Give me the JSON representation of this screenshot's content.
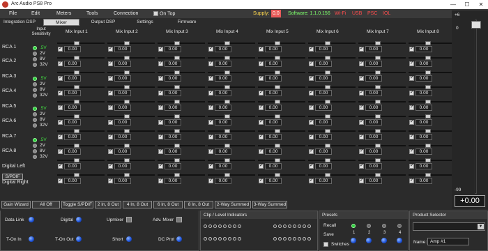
{
  "window": {
    "title": "Arc Audio PS8 Pro",
    "btn_min": "—",
    "btn_max": "☐",
    "btn_close": "✕"
  },
  "menu": {
    "items": [
      "File",
      "Edit",
      "Meters",
      "Tools",
      "Connection"
    ],
    "on_top_label": "On Top",
    "supply_label": "Supply:",
    "supply_value": "0.0",
    "software_label": "Software: 1.1.0.156",
    "wifi_label": "Wi-Fi",
    "usb_label": "USB",
    "psc_label": "PSC",
    "iol_label": "IOL",
    "colors": {
      "status_red": "#ff4d4d",
      "software_green": "#7dff6b",
      "supply_yellow": "#ffd84d"
    }
  },
  "tabs": [
    {
      "label": "Integration DSP",
      "active": false
    },
    {
      "label": "Mixer",
      "active": true
    },
    {
      "label": "Output DSP",
      "active": false
    },
    {
      "label": "Settings",
      "active": false
    },
    {
      "label": "Firmware",
      "active": false
    }
  ],
  "mixer": {
    "sensitivity_title": "Input Sensitivity",
    "columns": [
      "Mix Input 1",
      "Mix Input 2",
      "Mix Input 3",
      "Mix Input 4",
      "Mix Input 5",
      "Mix Input 6",
      "Mix Input 7",
      "Mix Input 8"
    ],
    "row_labels": [
      "RCA 1",
      "RCA 2",
      "RCA 3",
      "RCA 4",
      "RCA 5",
      "RCA 6",
      "RCA 7",
      "RCA 8",
      "Digital Left",
      "Digital Right"
    ],
    "sensitivity_options": [
      ".5V",
      "2V",
      "8V",
      "32V"
    ],
    "sensitivity_selected": [
      ".5V",
      ".5V",
      ".5V",
      ".5V"
    ],
    "cell_value": "0.00",
    "rows_visible": 10,
    "spdif_label": "S/PDIF"
  },
  "master": {
    "top_label": "+6",
    "zero_label": "0",
    "bottom_label": "-99",
    "value": "+0.00"
  },
  "bottom_buttons": [
    "Gain Wizard",
    "All Off",
    "Toggle S/PDIF",
    "2 In, 8 Out",
    "4 In, 8 Out",
    "6 In, 8 Out",
    "8 In, 8 Out",
    "2-Way Summed",
    "3-Way Summed"
  ],
  "status_panel": {
    "data_link": "Data Link",
    "digital": "Digital",
    "upmixer": "Upmixer",
    "adv_mixer": "Adv. Mixer",
    "t_on_in": "T-On In",
    "t_on_out": "T-On Out",
    "short": "Short",
    "dc_prot": "DC Prot"
  },
  "clip_panel": {
    "title": "Clip / Level Indicators"
  },
  "presets_panel": {
    "title": "Presets",
    "recall": "Recall",
    "save": "Save",
    "switches": "Switches",
    "numbers": [
      "1",
      "2",
      "3",
      "4"
    ],
    "selected": "1"
  },
  "product_panel": {
    "title": "Product Selector",
    "name_label": "Name:",
    "name_value": "Amp #1"
  }
}
